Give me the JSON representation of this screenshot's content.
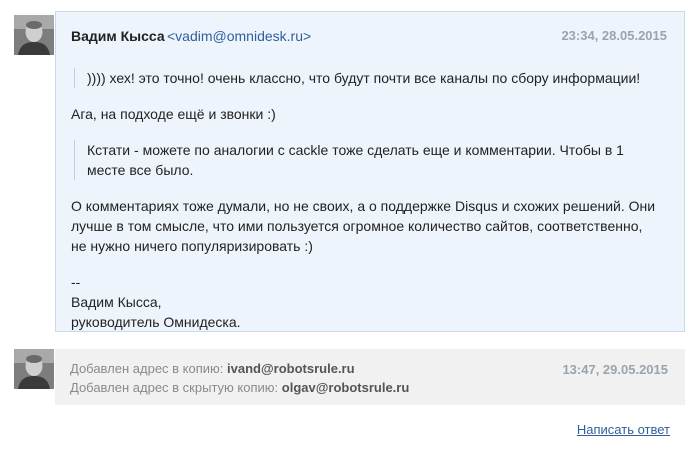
{
  "message": {
    "author_name": "Вадим Кысса",
    "author_email": "<vadim@omnidesk.ru>",
    "timestamp": "23:34, 28.05.2015",
    "quote1": ")))) хех! это точно! очень классно, что будут почти все каналы по сбору информации!",
    "para1": "Ага, на подходе ещё и звонки :)",
    "quote2_line1": "Кстати - можете по аналогии с cackle тоже сделать еще и комментарии. Чтобы в 1",
    "quote2_line2": "месте все было.",
    "para2_line1": "О комментариях тоже думали, но не своих, а о поддержке Disqus и схожих решений. Они",
    "para2_line2": "лучше в том смысле, что ими пользуется огромное количество сайтов, соответственно,",
    "para2_line3": "не нужно ничего популяризировать :)",
    "sig_dashes": "--",
    "sig_name": "Вадим Кысса,",
    "sig_title": "руководитель Омнидеска."
  },
  "event": {
    "cc_label": "Добавлен адрес в копию:",
    "cc_address": "ivand@robotsrule.ru",
    "bcc_label": "Добавлен адрес в скрытую копию:",
    "bcc_address": "olgav@robotsrule.ru",
    "timestamp": "13:47, 29.05.2015"
  },
  "reply_link": "Написать ответ",
  "colors": {
    "card_bg": "#eef4fc",
    "card_border": "#c9d9ea",
    "event_bg": "#f1f1f1",
    "link": "#2e5f9c",
    "muted": "#9aa4ad"
  },
  "icons": [
    "user-avatar-photo"
  ]
}
